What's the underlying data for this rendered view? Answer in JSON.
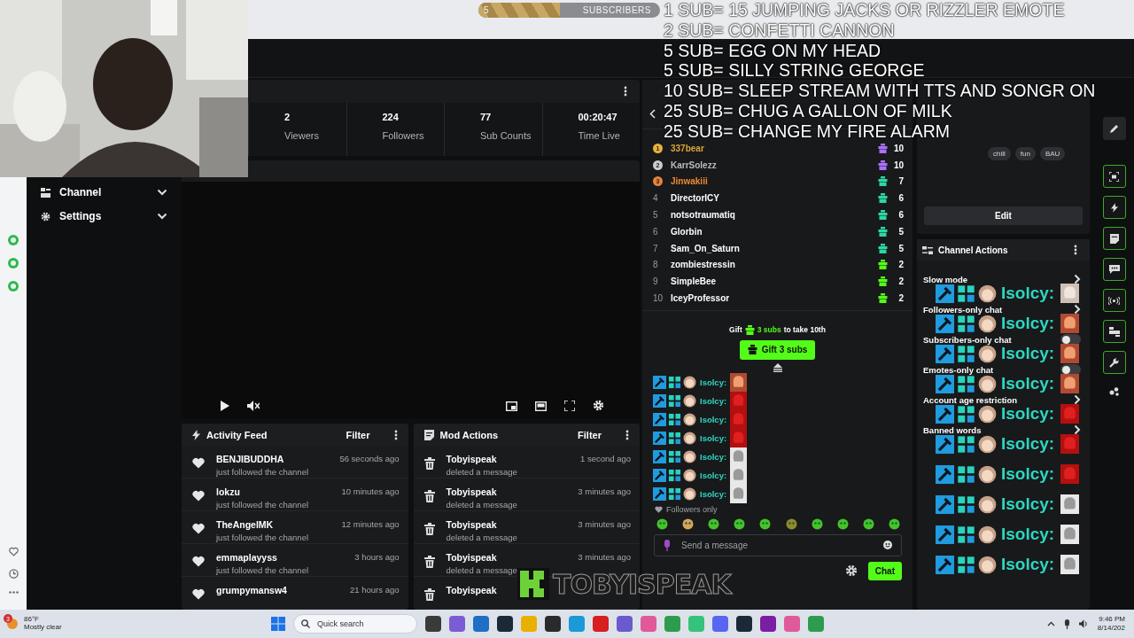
{
  "goal": {
    "count": "5",
    "label": "SUBSCRIBERS",
    "level": 0.45
  },
  "nav": [
    {
      "label": "Channel",
      "expanded": false
    },
    {
      "label": "Settings",
      "expanded": false
    }
  ],
  "stats": [
    {
      "value": "2",
      "label": "Viewers"
    },
    {
      "value": "224",
      "label": "Followers"
    },
    {
      "value": "77",
      "label": "Sub Counts"
    },
    {
      "value": "00:20:47",
      "label": "Time Live"
    }
  ],
  "activity_feed": {
    "title": "Activity Feed",
    "filter": "Filter",
    "items": [
      {
        "name": "BENJIBUDDHA",
        "time": "56 seconds ago",
        "action": "just followed the channel"
      },
      {
        "name": "lokzu",
        "time": "10 minutes ago",
        "action": "just followed the channel"
      },
      {
        "name": "TheAngelMK",
        "time": "12 minutes ago",
        "action": "just followed the channel"
      },
      {
        "name": "emmaplayyss",
        "time": "3 hours ago",
        "action": "just followed the channel"
      },
      {
        "name": "grumpymansw4",
        "time": "21 hours ago"
      }
    ]
  },
  "mod_actions": {
    "title": "Mod Actions",
    "filter": "Filter",
    "items": [
      {
        "name": "Tobyispeak",
        "time": "1 second ago",
        "action": "deleted a message"
      },
      {
        "name": "Tobyispeak",
        "time": "3 minutes ago",
        "action": "deleted a message"
      },
      {
        "name": "Tobyispeak",
        "time": "3 minutes ago",
        "action": "deleted a message"
      },
      {
        "name": "Tobyispeak",
        "time": "3 minutes ago",
        "action": "deleted a message"
      },
      {
        "name": "Tobyispeak"
      }
    ]
  },
  "leaderboard": [
    {
      "kind": "medal",
      "rank": "1",
      "name": "337bear",
      "count": "10",
      "color": "#a970ff"
    },
    {
      "kind": "medal",
      "rank": "2",
      "name": "KarrSolezz",
      "count": "10",
      "color": "#a970ff"
    },
    {
      "kind": "medal",
      "rank": "3",
      "name": "Jinwakiii",
      "count": "7",
      "color": "#2ed6a5"
    },
    {
      "kind": "number",
      "rank": "4",
      "name": "DirectorICY",
      "count": "6",
      "color": "#2ed6a5"
    },
    {
      "kind": "number",
      "rank": "5",
      "name": "notsotraumatiq",
      "count": "6",
      "color": "#2ed6a5"
    },
    {
      "kind": "number",
      "rank": "6",
      "name": "Glorbin",
      "count": "5",
      "color": "#2ed6a5"
    },
    {
      "kind": "number",
      "rank": "7",
      "name": "Sam_On_Saturn",
      "count": "5",
      "color": "#2ed6a5"
    },
    {
      "kind": "number",
      "rank": "8",
      "name": "zombiestressin",
      "count": "2",
      "color": "#53fc18"
    },
    {
      "kind": "number",
      "rank": "9",
      "name": "SimpleBee",
      "count": "2",
      "color": "#53fc18"
    },
    {
      "kind": "number",
      "rank": "10",
      "name": "IceyProfessor",
      "count": "2",
      "color": "#53fc18"
    }
  ],
  "gift_prompt": {
    "before": "Gift",
    "amount": "3 subs",
    "after": "to take 10th",
    "button": "Gift 3 subs"
  },
  "chat_messages": [
    {
      "user": "Isolcy:"
    },
    {
      "user": "Isolcy:"
    },
    {
      "user": "Isolcy:"
    },
    {
      "user": "Isolcy:"
    },
    {
      "user": "Isolcy:"
    },
    {
      "user": "Isolcy:"
    },
    {
      "user": "Isolcy:"
    }
  ],
  "chat_mode": "Followers only",
  "emote_bar": [
    {
      "kind": "green"
    },
    {
      "kind": "tan"
    },
    {
      "kind": "green"
    },
    {
      "kind": "green"
    },
    {
      "kind": "green"
    },
    {
      "kind": "olive"
    },
    {
      "kind": "green"
    },
    {
      "kind": "green"
    },
    {
      "kind": "green"
    },
    {
      "kind": "green"
    }
  ],
  "chat_input": {
    "placeholder": "Send a message"
  },
  "chat_button": "Chat",
  "tags": [
    "chill",
    "fun",
    "BAU"
  ],
  "edit_button": "Edit",
  "channel_actions": {
    "title": "Channel Actions",
    "items": [
      {
        "kind": "link",
        "label": "Slow mode"
      },
      {
        "kind": "link",
        "label": "Followers-only chat"
      },
      {
        "kind": "toggle",
        "label": "Subscribers-only chat",
        "on": false
      },
      {
        "kind": "toggle",
        "label": "Emotes-only chat",
        "on": false
      },
      {
        "kind": "link",
        "label": "Account age restriction"
      },
      {
        "kind": "link",
        "label": "Banned words"
      }
    ]
  },
  "overlay_goals": [
    "1 SUB= 15 JUMPING JACKS OR RIZZLER EMOTE",
    "2 SUB= CONFETTI CANNON",
    "5 SUB= EGG ON MY HEAD",
    "5 SUB= SILLY STRING GEORGE",
    "10 SUB= SLEEP STREAM WITH TTS AND SONGR ON",
    "25 SUB= CHUG A GALLON OF MILK",
    "25 SUB= CHANGE MY FIRE ALARM"
  ],
  "overlay_chat": [
    {
      "user": "Isolcy:"
    },
    {
      "user": "Isolcy:"
    },
    {
      "user": "Isolcy:"
    },
    {
      "user": "Isolcy:"
    },
    {
      "user": "Isolcy:"
    },
    {
      "user": "Isolcy:"
    },
    {
      "user": "Isolcy:"
    },
    {
      "user": "Isolcy:"
    },
    {
      "user": "Isolcy:"
    },
    {
      "user": "Isolcy:"
    }
  ],
  "overlay_logo": "TOBYISPEAK",
  "taskbar": {
    "weather_badge": "3",
    "temperature": "86°F",
    "weather": "Mostly clear",
    "search": {
      "placeholder": "Quick search"
    },
    "apps": [
      {
        "color": "#3a3a3a"
      },
      {
        "color": "#7b5cd6"
      },
      {
        "color": "#1f6fc5"
      },
      {
        "color": "#1b2838"
      },
      {
        "color": "#e8b000"
      },
      {
        "color": "#2a2a2a"
      },
      {
        "color": "#1a9ad6"
      },
      {
        "color": "#d81e1e"
      },
      {
        "color": "#6a5acd"
      },
      {
        "color": "#e05a9b"
      },
      {
        "color": "#2e9c4f"
      },
      {
        "color": "#35c27a"
      },
      {
        "color": "#5865f2"
      },
      {
        "color": "#1b2838"
      },
      {
        "color": "#7a1fa2"
      },
      {
        "color": "#e05a9b"
      },
      {
        "color": "#2e9c4f"
      }
    ],
    "time": "9:46 PM",
    "date": "8/14/202"
  }
}
